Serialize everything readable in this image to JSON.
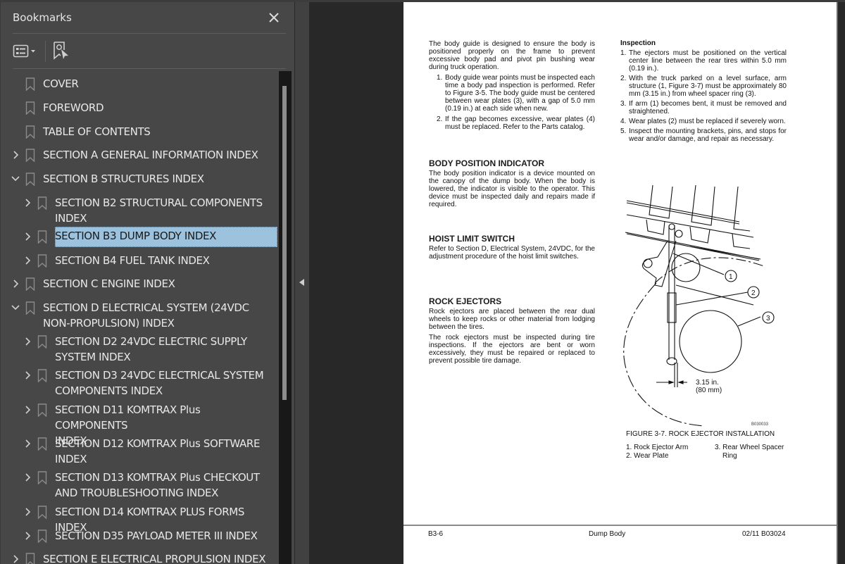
{
  "sidebar": {
    "title": "Bookmarks",
    "close_label": "Close",
    "toolbar": {
      "options_icon": "list-options-icon",
      "find_icon": "find-current-bookmark-icon"
    },
    "items": [
      {
        "label": "COVER",
        "level": 0,
        "expander": "none"
      },
      {
        "label": "FOREWORD",
        "level": 0,
        "expander": "none"
      },
      {
        "label": "TABLE OF CONTENTS",
        "level": 0,
        "expander": "none"
      },
      {
        "label": "SECTION A GENERAL INFORMATION INDEX",
        "level": 0,
        "expander": "collapsed"
      },
      {
        "label": "SECTION B STRUCTURES INDEX",
        "level": 0,
        "expander": "expanded"
      },
      {
        "label": "SECTION B2 STRUCTURAL COMPONENTS INDEX",
        "level": 1,
        "expander": "collapsed",
        "line1": "SECTION B2 STRUCTURAL COMPONENTS",
        "line2": "INDEX"
      },
      {
        "label": "SECTION B3 DUMP BODY INDEX",
        "level": 1,
        "expander": "collapsed",
        "selected": true
      },
      {
        "label": "SECTION B4 FUEL TANK INDEX",
        "level": 1,
        "expander": "collapsed"
      },
      {
        "label": "SECTION C ENGINE INDEX",
        "level": 0,
        "expander": "collapsed"
      },
      {
        "label": "SECTION D ELECTRICAL SYSTEM (24VDC NON-PROPULSION) INDEX",
        "level": 0,
        "expander": "expanded",
        "line1": "SECTION D ELECTRICAL SYSTEM (24VDC",
        "line2": "NON-PROPULSION) INDEX"
      },
      {
        "label": "SECTION D2 24VDC ELECTRIC SUPPLY SYSTEM INDEX",
        "level": 1,
        "expander": "collapsed",
        "line1": "SECTION D2 24VDC ELECTRIC SUPPLY",
        "line2": "SYSTEM INDEX"
      },
      {
        "label": "SECTION D3 24VDC ELECTRICAL SYSTEM COMPONENTS INDEX",
        "level": 1,
        "expander": "collapsed",
        "line1": "SECTION D3 24VDC ELECTRICAL SYSTEM",
        "line2": "COMPONENTS INDEX"
      },
      {
        "label": "SECTION D11 KOMTRAX Plus COMPONENTS INDEX",
        "level": 1,
        "expander": "collapsed",
        "line1": "SECTION D11 KOMTRAX Plus COMPONENTS",
        "line2": "INDEX"
      },
      {
        "label": "SECTION D12 KOMTRAX Plus SOFTWARE INDEX",
        "level": 1,
        "expander": "collapsed",
        "line1": "SECTION D12 KOMTRAX Plus SOFTWARE",
        "line2": "INDEX"
      },
      {
        "label": "SECTION D13 KOMTRAX Plus CHECKOUT AND TROUBLESHOOTING INDEX",
        "level": 1,
        "expander": "collapsed",
        "line1": "SECTION D13 KOMTRAX Plus CHECKOUT",
        "line2": "AND TROUBLESHOOTING INDEX"
      },
      {
        "label": "SECTION D14 KOMTRAX PLUS FORMS INDEX",
        "level": 1,
        "expander": "collapsed"
      },
      {
        "label": "SECTION D35 PAYLOAD METER III INDEX",
        "level": 1,
        "expander": "collapsed"
      },
      {
        "label": "SECTION E ELECTRICAL PROPULSION INDEX",
        "level": 0,
        "expander": "collapsed"
      }
    ]
  },
  "document": {
    "left_column": {
      "intro": "The body guide is designed to ensure the body is positioned properly on the frame to prevent excessive body pad and pivot pin bushing wear during truck operation.",
      "guide_steps": [
        {
          "num": "1.",
          "text": "Body guide wear points must be inspected each time a body pad inspection is performed. Refer to Figure 3-5. The body guide must be centered between wear plates (3), with a gap of 5.0 mm (0.19 in.) at each side when new."
        },
        {
          "num": "2.",
          "text": "If the gap becomes excessive, wear plates (4) must be replaced. Refer to the Parts catalog."
        }
      ],
      "body_position_heading": "BODY POSITION INDICATOR",
      "body_position_text": "The body position indicator is a device mounted on the canopy of the dump body. When the body is lowered, the indicator is visible to the operator. This device must be inspected daily and repairs made if required.",
      "hoist_heading": "HOIST LIMIT SWITCH",
      "hoist_text": "Refer to Section D, Electrical System, 24VDC, for the adjustment procedure of the hoist limit switches.",
      "rock_heading": "ROCK EJECTORS",
      "rock_text1": "Rock ejectors are placed between the rear dual wheels to keep rocks or other material from lodging between the tires.",
      "rock_text2": "The rock ejectors must be inspected during tire inspections. If the ejectors are bent or worn excessively, they must be repaired or replaced to prevent possible tire damage."
    },
    "right_column": {
      "inspection_heading": "Inspection",
      "inspection_steps": [
        {
          "num": "1.",
          "text": "The ejectors must be positioned on the vertical center line between the rear tires within 5.0 mm (0.19 in.)."
        },
        {
          "num": "2.",
          "text": "With the truck parked on a level surface, arm structure (1, Figure 3-7) must be approximately 80 mm (3.15 in.) from wheel spacer ring (3)."
        },
        {
          "num": "3.",
          "text": "If arm (1) becomes bent, it must be removed and straightened."
        },
        {
          "num": "4.",
          "text": "Wear plates (2) must be replaced if severely worn."
        },
        {
          "num": "5.",
          "text": "Inspect the mounting brackets, pins, and stops for wear and/or damage, and repair as necessary."
        }
      ]
    },
    "figure": {
      "callouts": [
        "1",
        "2",
        "3"
      ],
      "dimension_line1": "3.15 in.",
      "dimension_line2": "(80 mm)",
      "figure_id": "B030033",
      "caption": "FIGURE 3-7. ROCK EJECTOR INSTALLATION",
      "legend": [
        {
          "text": "1. Rock Ejector Arm"
        },
        {
          "text": "2. Wear Plate"
        },
        {
          "text": "3. Rear Wheel Spacer"
        },
        {
          "text": "Ring"
        }
      ]
    },
    "footer": {
      "page_number": "B3-6",
      "section": "Dump Body",
      "doc_code": "02/11 B03024"
    }
  }
}
